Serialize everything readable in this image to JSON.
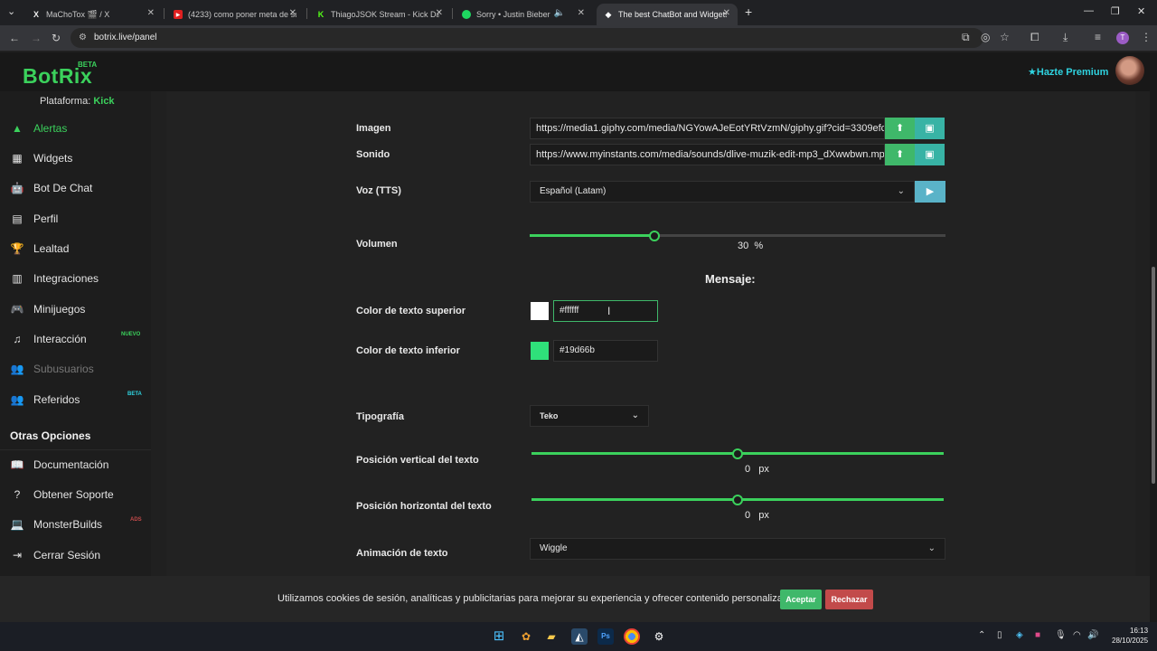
{
  "browser": {
    "tabs": [
      {
        "title": "MaChoTox 🎬 / X",
        "icon": "x-logo-icon"
      },
      {
        "title": "(4233) como poner meta de sub",
        "icon": "youtube-icon"
      },
      {
        "title": "ThiagoJSOK Stream - Kick Dash",
        "icon": "kick-icon"
      },
      {
        "title": "Sorry • Justin Bieber",
        "icon": "spotify-icon"
      },
      {
        "title": "The best ChatBot and Widgets",
        "icon": "botrix-icon"
      }
    ],
    "url": "botrix.live/panel",
    "profile_initial": "T"
  },
  "header": {
    "logo": "BotRix",
    "beta": "BETA",
    "premium": "Hazte Premium"
  },
  "sidebar": {
    "platform_label": "Plataforma:",
    "platform_value": "Kick",
    "items": [
      {
        "label": "Alertas"
      },
      {
        "label": "Widgets"
      },
      {
        "label": "Bot De Chat"
      },
      {
        "label": "Perfil"
      },
      {
        "label": "Lealtad"
      },
      {
        "label": "Integraciones"
      },
      {
        "label": "Minijuegos"
      },
      {
        "label": "Interacción",
        "badge": "NUEVO"
      },
      {
        "label": "Subusuarios"
      },
      {
        "label": "Referidos",
        "badge": "BETA"
      }
    ],
    "section_title": "Otras Opciones",
    "other_items": [
      {
        "label": "Documentación"
      },
      {
        "label": "Obtener Soporte"
      },
      {
        "label": "MonsterBuilds",
        "badge": "ADS"
      },
      {
        "label": "Cerrar Sesión"
      }
    ]
  },
  "form": {
    "imagen_label": "Imagen",
    "imagen_value": "https://media1.giphy.com/media/NGYowAJeEotYRtVzmN/giphy.gif?cid=3309efc1",
    "sonido_label": "Sonido",
    "sonido_value": "https://www.myinstants.com/media/sounds/dlive-muzik-edit-mp3_dXwwbwn.mp",
    "voz_label": "Voz (TTS)",
    "voz_value": "Español (Latam)",
    "volumen_label": "Volumen",
    "volumen_value": "30",
    "volumen_unit": "%",
    "volumen_fraction": 0.3,
    "mensaje_title": "Mensaje:",
    "color_sup_label": "Color de texto superior",
    "color_sup_value": "#ffffff",
    "color_inf_label": "Color de texto inferior",
    "color_inf_value": "#19d66b",
    "tipografia_label": "Tipografía",
    "tipografia_value": "Teko",
    "pos_v_label": "Posición vertical del texto",
    "pos_v_value": "0",
    "pos_h_label": "Posición horizontal del texto",
    "pos_h_value": "0",
    "px_unit": "px",
    "animacion_label": "Animación de texto",
    "animacion_value": "Wiggle"
  },
  "cookie": {
    "text": "Utilizamos cookies de sesión, analíticas y publicitarias para mejorar su experiencia y ofrecer contenido personalizado.",
    "accept": "Aceptar",
    "reject": "Rechazar"
  },
  "taskbar": {
    "time": "16:13",
    "date": "28/10/2025"
  },
  "colors": {
    "accent": "#3bd15c",
    "premium": "#2fd3e0",
    "swatch_top": "#ffffff",
    "swatch_bottom": "#2fe07a"
  }
}
